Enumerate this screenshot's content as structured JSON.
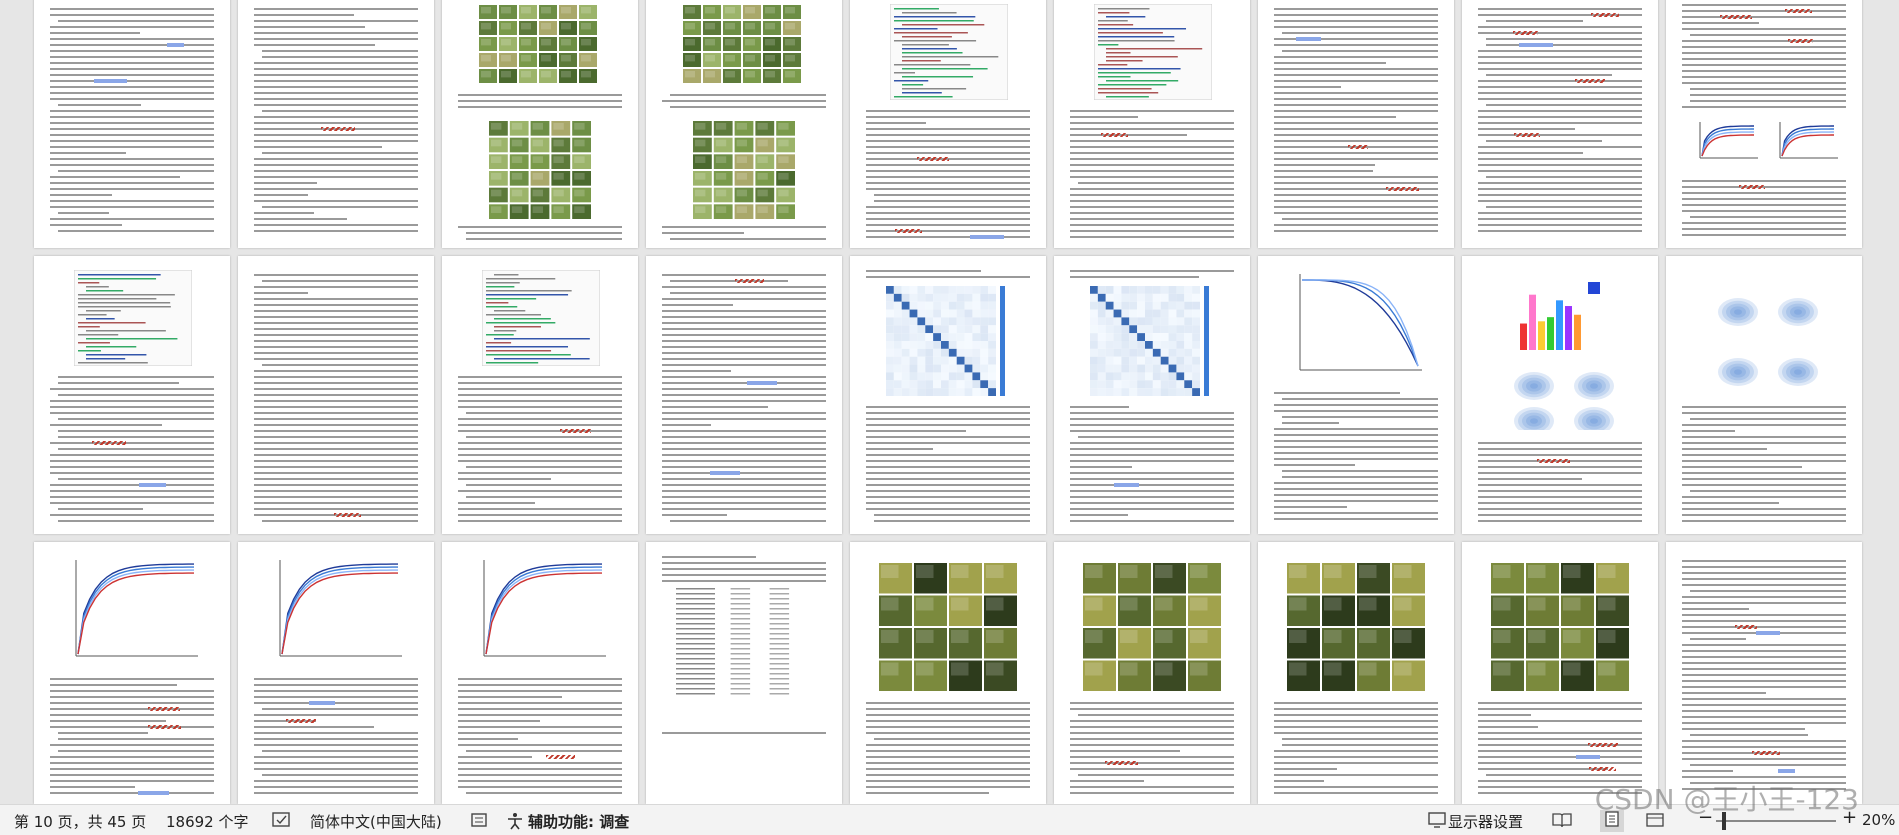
{
  "statusbar": {
    "page_info": "第 10 页，共 45 页",
    "word_count": "18692 个字",
    "language": "简体中文(中国大陆)",
    "accessibility": "辅助功能: 调查",
    "display_settings": "显示器设置",
    "zoom": "20%"
  },
  "watermark": "CSDN @王小王-123",
  "document": {
    "rows": 3,
    "pages_per_row": 9,
    "figure_types": [
      "text",
      "text",
      "image-grid",
      "image-grid",
      "code",
      "code",
      "text",
      "text",
      "chart",
      "code",
      "text",
      "code",
      "text",
      "heatmap",
      "heatmap",
      "line-chart",
      "bar-chart",
      "kde-plots",
      "line-chart",
      "line-chart",
      "line-chart",
      "table",
      "photo-grid",
      "photo-grid",
      "photo-grid",
      "photo-grid",
      "text"
    ],
    "colors": {
      "page": "#ffffff",
      "background": "#e6e6e6",
      "squiggle": "#c0392b",
      "highlight": "#8aa6e8"
    }
  }
}
